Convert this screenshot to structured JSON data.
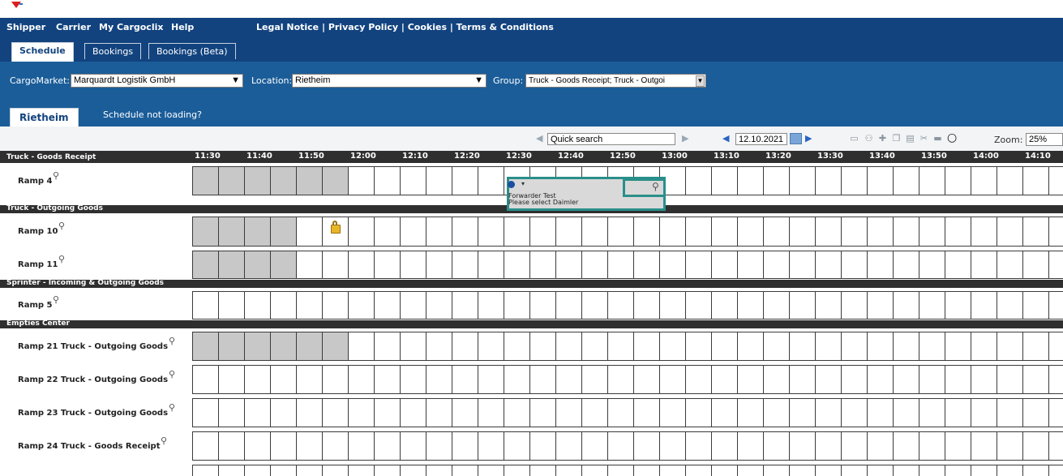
{
  "nav": {
    "items": [
      "Shipper",
      "Carrier",
      "My Cargoclix",
      "Help"
    ],
    "legal": "Legal Notice | Privacy Policy | Cookies | Terms & Conditions"
  },
  "tabs": [
    "Schedule",
    "Bookings",
    "Bookings (Beta)"
  ],
  "filters": {
    "cargomarket_label": "CargoMarket:",
    "cargomarket_value": "Marquardt Logistik GmbH",
    "location_label": "Location:",
    "location_value": "Rietheim",
    "group_label": "Group:",
    "group_value": "Truck - Goods Receipt; Truck - Outgoi"
  },
  "location_tab": "Rietheim",
  "schedule_help": "Schedule not loading?",
  "toolbar": {
    "quick_search": "Quick search",
    "date": "12.10.2021",
    "zoom_label": "Zoom:",
    "zoom_value": "25%"
  },
  "times": [
    "11:30",
    "11:40",
    "11:50",
    "12:00",
    "12:10",
    "12:20",
    "12:30",
    "12:40",
    "12:50",
    "13:00",
    "13:10",
    "13:20",
    "13:30",
    "13:40",
    "13:50",
    "14:00",
    "14:10"
  ],
  "first_group": "Truck - Goods Receipt",
  "groups": [
    {
      "name": "Truck - Goods Receipt",
      "ramps": [
        "Ramp 4"
      ]
    },
    {
      "name": "Truck - Outgoing Goods",
      "ramps": [
        "Ramp 10",
        "Ramp 11"
      ]
    },
    {
      "name": "Sprinter - Incoming & Outgoing Goods",
      "ramps": [
        "Ramp 5"
      ]
    },
    {
      "name": "Empties Center",
      "ramps": [
        "Ramp 21 Truck - Outgoing Goods",
        "Ramp 22 Truck - Outgoing Goods",
        "Ramp 23 Truck - Outgoing Goods",
        "Ramp 24 Truck - Goods Receipt"
      ]
    }
  ],
  "booking": {
    "line1": "Forwarder Test",
    "line2": "Please select Daimler"
  },
  "icons": {
    "ramp_detail": "magnifier-icon",
    "locked_slot": "lock-icon",
    "calendar": "calendar-icon"
  }
}
